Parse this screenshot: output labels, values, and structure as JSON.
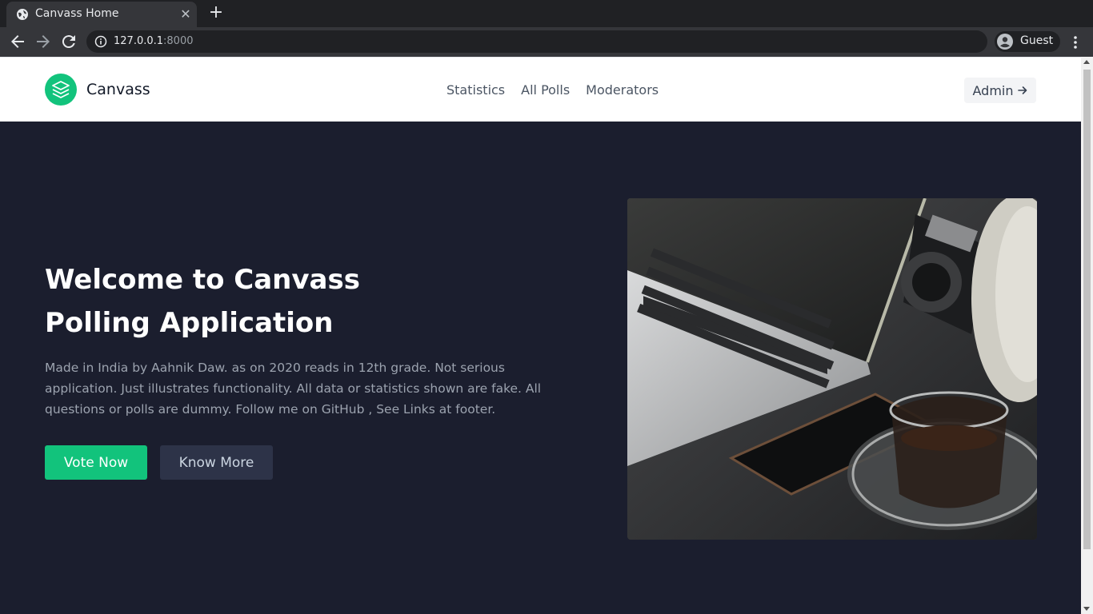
{
  "browser": {
    "tab_title": "Canvass Home",
    "url_host": "127.0.0.1",
    "url_port": ":8000",
    "profile_label": "Guest",
    "icons": {
      "favicon": "globe-icon",
      "close": "close-icon",
      "new_tab": "plus-icon",
      "back": "back-arrow-icon",
      "forward": "forward-arrow-icon",
      "reload": "reload-icon",
      "info": "info-icon",
      "profile": "person-icon",
      "menu": "more-vertical-icon"
    }
  },
  "header": {
    "brand": "Canvass",
    "logo_icon": "layers-icon",
    "nav": [
      "Statistics",
      "All Polls",
      "Moderators"
    ],
    "admin_label": "Admin",
    "admin_icon": "arrow-right-icon"
  },
  "hero": {
    "title_line1": "Welcome to Canvass",
    "title_line2": "Polling Application",
    "description": "Made in India by Aahnik Daw. as on 2020 reads in 12th grade. Not serious application. Just illustrates functionality. All data or statistics shown are fake. All questions or polls are dummy. Follow me on GitHub , See Links at footer.",
    "vote_label": "Vote Now",
    "more_label": "Know More",
    "image_subject": "laptop-camera-phone-coffee-photo"
  },
  "colors": {
    "accent": "#12c37c",
    "hero_bg": "#1b1e2e",
    "secondary_btn": "#2d3348"
  }
}
